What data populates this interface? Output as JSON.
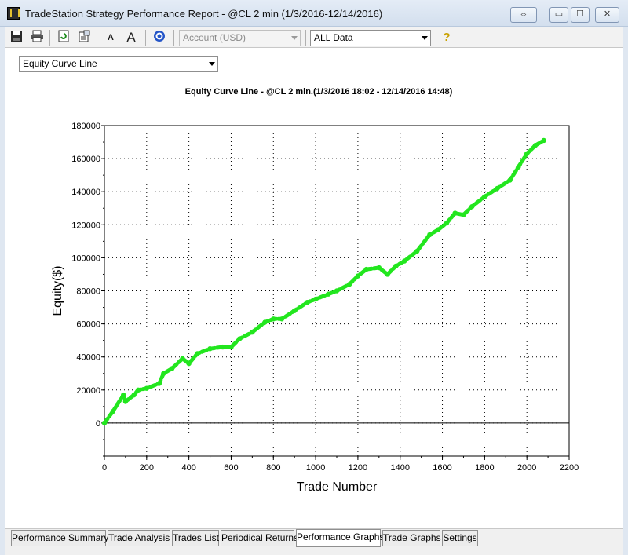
{
  "window": {
    "title": "TradeStation Strategy Performance Report - @CL 2 min (1/3/2016-12/14/2016)",
    "buttons": {
      "restore_wide": "⇔",
      "minimize": "▭",
      "maximize": "☐",
      "close": "✕"
    }
  },
  "toolbar": {
    "icons": [
      "save-icon",
      "print-icon",
      "refresh-icon",
      "properties-icon",
      "font-decrease-icon",
      "font-increase-icon",
      "target-icon",
      "help-icon"
    ],
    "font_small_label": "A",
    "font_large_label": "A",
    "help_label": "?",
    "account_select": "Account (USD)",
    "data_select": "ALL Data"
  },
  "graph_type_select": "Equity Curve Line",
  "colors": {
    "series": "#22e61e",
    "drawdown": "#000000"
  },
  "chart_data": {
    "type": "line",
    "title": "Equity Curve Line - @CL 2 min.(1/3/2016 18:02 - 12/14/2016 14:48)",
    "xlabel": "Trade Number",
    "ylabel": "Equity($)",
    "xlim": [
      0,
      2200
    ],
    "ylim": [
      -20000,
      180000
    ],
    "x_ticks": [
      "0",
      "200",
      "400",
      "600",
      "800",
      "1000",
      "1200",
      "1400",
      "1600",
      "1800",
      "2000",
      "2200"
    ],
    "y_ticks": [
      "0",
      "20000",
      "40000",
      "60000",
      "80000",
      "100000",
      "120000",
      "140000",
      "160000",
      "180000"
    ],
    "grid": true,
    "series": [
      {
        "x": [
          0,
          40,
          90,
          100,
          140,
          160,
          200,
          260,
          280,
          320,
          370,
          400,
          440,
          500,
          560,
          600,
          640,
          700,
          760,
          800,
          840,
          900,
          960,
          1000,
          1060,
          1100,
          1160,
          1200,
          1240,
          1300,
          1340,
          1380,
          1420,
          1480,
          1540,
          1580,
          1620,
          1660,
          1700,
          1740,
          1800,
          1860,
          1920,
          1960,
          2000,
          2040,
          2080
        ],
        "y": [
          0,
          7000,
          17000,
          13000,
          17000,
          20000,
          21000,
          24000,
          30000,
          33000,
          39000,
          36000,
          42000,
          45000,
          46000,
          46000,
          51000,
          55000,
          61000,
          63000,
          63000,
          68000,
          73000,
          75000,
          78000,
          80000,
          84000,
          89000,
          93000,
          94000,
          90000,
          95000,
          98000,
          104000,
          114000,
          117000,
          121000,
          127000,
          126000,
          131000,
          137000,
          142000,
          147000,
          155000,
          163000,
          168000,
          171000
        ]
      }
    ]
  },
  "tabs": [
    "Performance Summary",
    "Trade Analysis",
    "Trades List",
    "Periodical Returns",
    "Performance Graphs",
    "Trade Graphs",
    "Settings"
  ],
  "active_tab": "Performance Graphs"
}
